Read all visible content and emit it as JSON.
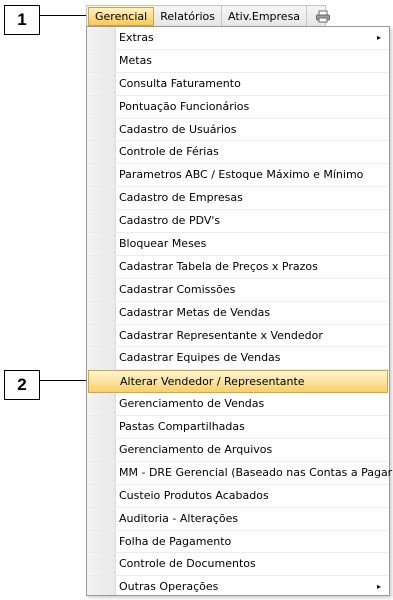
{
  "callouts": [
    "1",
    "2"
  ],
  "menubar": {
    "items": [
      "Gerencial",
      "Relatórios",
      "Ativ.Empresa"
    ],
    "printer_icon": "printer-icon"
  },
  "menu": {
    "items": [
      "Extras",
      "Metas",
      "Consulta Faturamento",
      "Pontuação Funcionários",
      "Cadastro de Usuários",
      "Controle de Férias",
      "Parametros ABC / Estoque Máximo e Mínimo",
      "Cadastro de Empresas",
      "Cadastro de PDV's",
      "Bloquear Meses",
      "Cadastrar Tabela de Preços x Prazos",
      "Cadastrar Comissões",
      "Cadastrar Metas de Vendas",
      "Cadastrar Representante x Vendedor",
      "Cadastrar Equipes de Vendas",
      "Alterar Vendedor / Representante",
      "Gerenciamento de Vendas",
      "Pastas Compartilhadas",
      "Gerenciamento de Arquivos",
      "MM - DRE Gerencial (Baseado nas Contas a Pagar)",
      "Custeio Produtos Acabados",
      "Auditoria - Alterações",
      "Folha de Pagamento",
      "Controle de Documentos",
      "Outras Operações"
    ],
    "submenu_arrow": "▸"
  },
  "colors": {
    "highlight": "#f9cf6a",
    "highlight_border": "#d9a63c"
  }
}
